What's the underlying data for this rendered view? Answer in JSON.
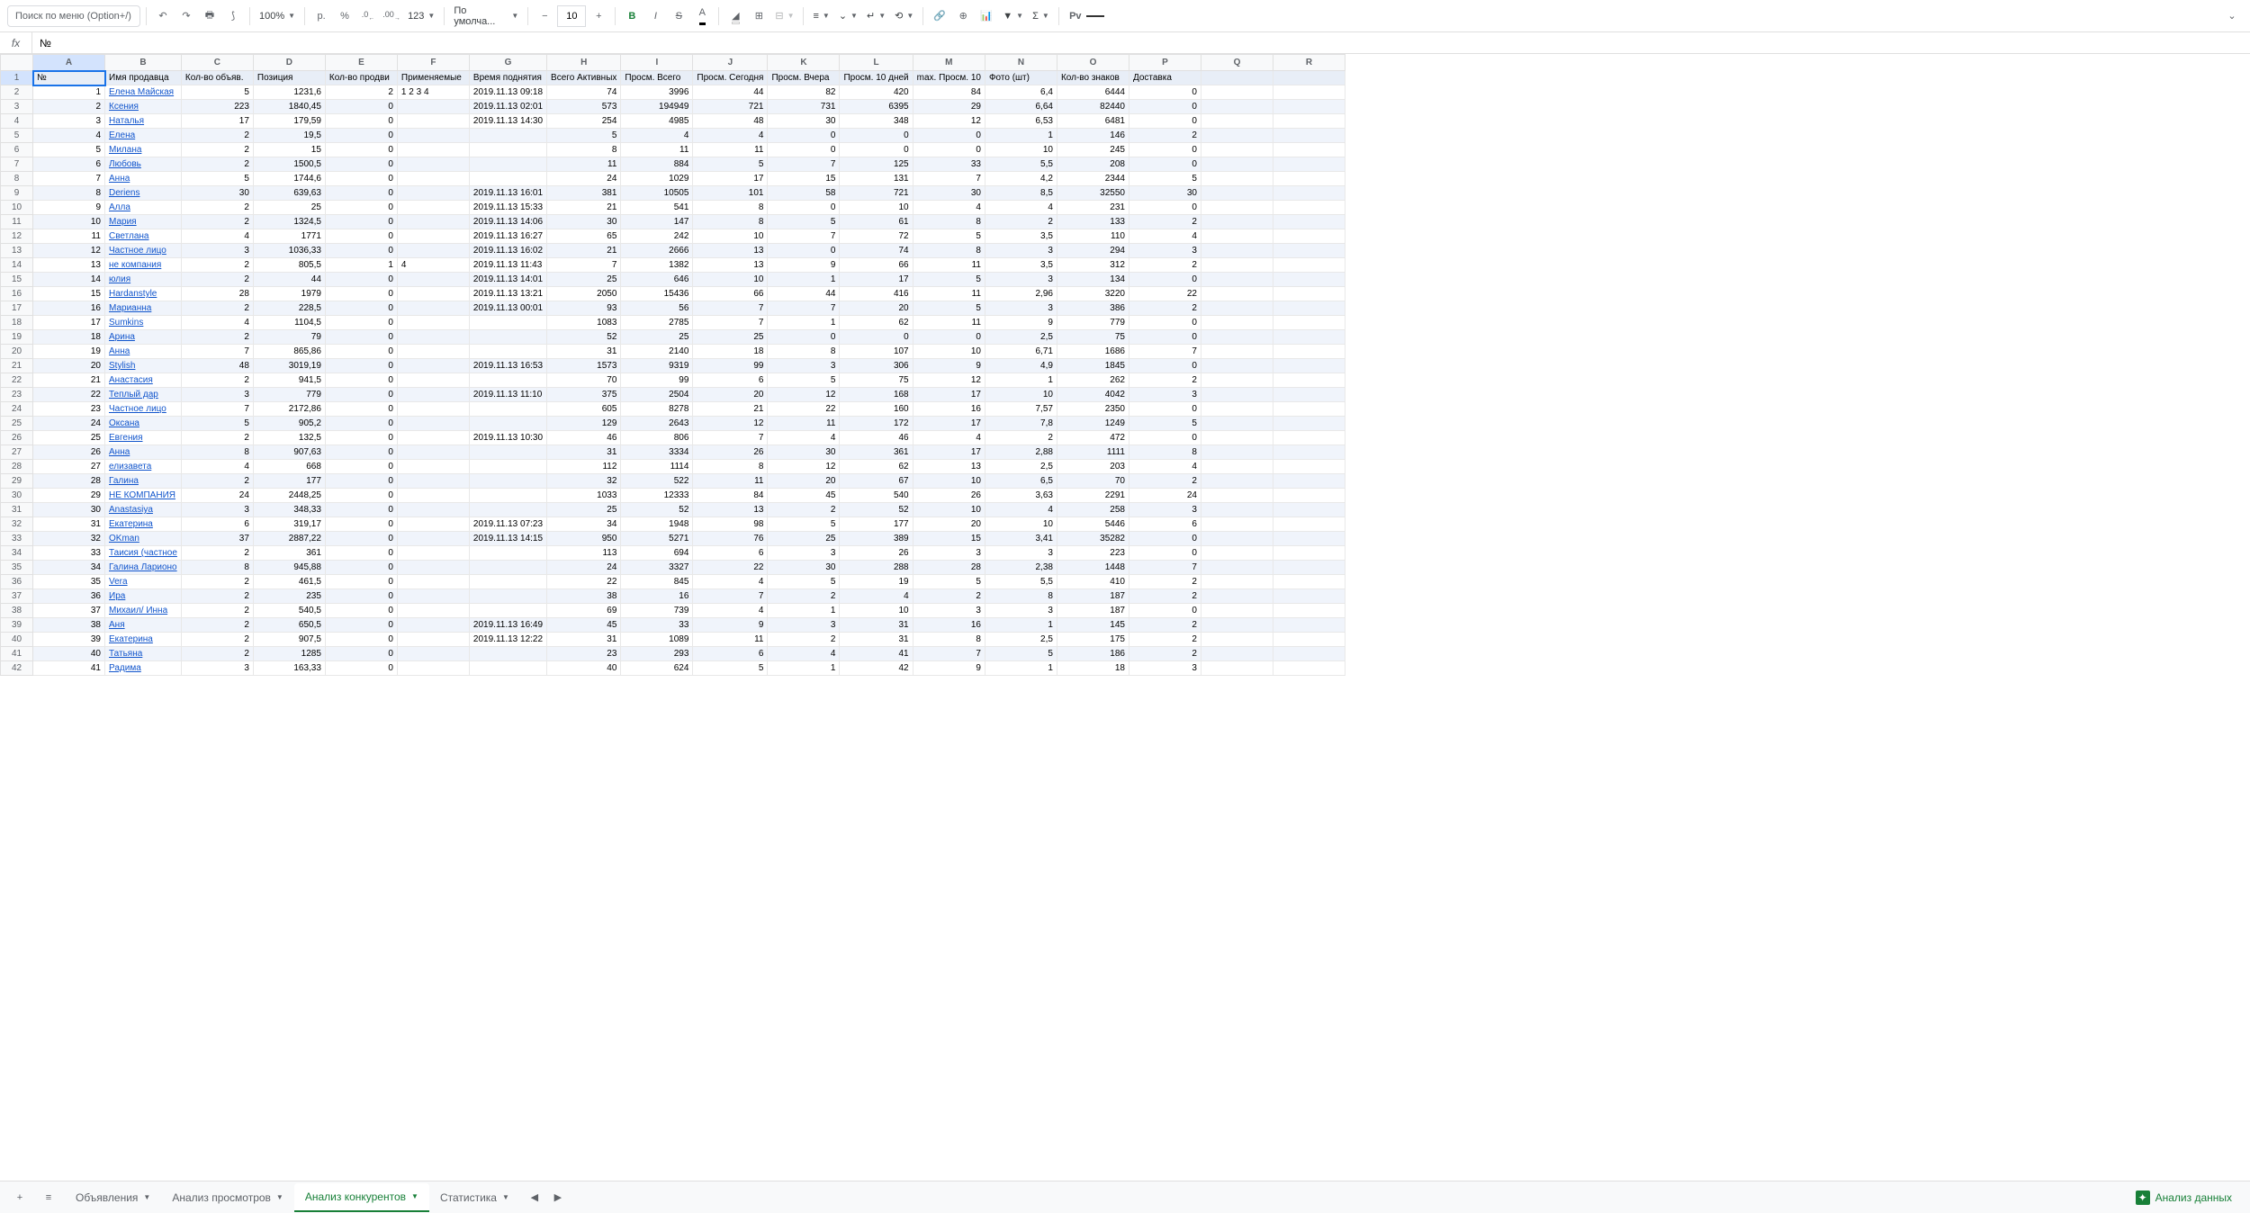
{
  "toolbar": {
    "search_placeholder": "Поиск по меню (Option+/)",
    "zoom": "100%",
    "currency": "р.",
    "percent": "%",
    "dec_minus": ".0",
    "dec_plus": ".00",
    "format_123": "123",
    "font": "По умолча...",
    "fontsize": "10",
    "p_label": "Рv"
  },
  "formula": {
    "fx": "fx",
    "value": "№"
  },
  "columns": [
    "A",
    "B",
    "C",
    "D",
    "E",
    "F",
    "G",
    "H",
    "I",
    "J",
    "K",
    "L",
    "M",
    "N",
    "O",
    "P",
    "Q",
    "R"
  ],
  "headers": [
    "№",
    "Имя продавца",
    "Кол-во объяв.",
    "Позиция",
    "Кол-во продви",
    "Применяемые",
    "Время поднятия",
    "Всего Активных",
    "Просм. Всего",
    "Просм. Сегодня",
    "Просм. Вчера",
    "Просм. 10 дней",
    "max. Просм. 10",
    "Фото (шт)",
    "Кол-во знаков",
    "Доставка",
    "",
    ""
  ],
  "rows": [
    [
      1,
      "Елена Майская",
      5,
      "1231,6",
      2,
      "1 2 3 4",
      "2019.11.13 09:18",
      74,
      3996,
      44,
      82,
      420,
      84,
      "6,4",
      6444,
      0
    ],
    [
      2,
      "Ксения",
      223,
      "1840,45",
      0,
      "",
      "2019.11.13 02:01",
      573,
      194949,
      721,
      731,
      6395,
      29,
      "6,64",
      82440,
      0
    ],
    [
      3,
      "Наталья",
      17,
      "179,59",
      0,
      "",
      "2019.11.13 14:30",
      254,
      4985,
      48,
      30,
      348,
      12,
      "6,53",
      6481,
      0
    ],
    [
      4,
      "Елена",
      2,
      "19,5",
      0,
      "",
      "",
      5,
      4,
      4,
      0,
      0,
      0,
      1,
      146,
      2
    ],
    [
      5,
      "Милана",
      2,
      15,
      0,
      "",
      "",
      8,
      11,
      11,
      0,
      0,
      0,
      10,
      245,
      0
    ],
    [
      6,
      "Любовь",
      2,
      "1500,5",
      0,
      "",
      "",
      11,
      884,
      5,
      7,
      125,
      33,
      "5,5",
      208,
      0
    ],
    [
      7,
      "Анна",
      5,
      "1744,6",
      0,
      "",
      "",
      24,
      1029,
      17,
      15,
      131,
      7,
      "4,2",
      2344,
      5
    ],
    [
      8,
      "Deriens",
      30,
      "639,63",
      0,
      "",
      "2019.11.13 16:01",
      381,
      10505,
      101,
      58,
      721,
      30,
      "8,5",
      32550,
      30
    ],
    [
      9,
      "Алла",
      2,
      25,
      0,
      "",
      "2019.11.13 15:33",
      21,
      541,
      8,
      0,
      10,
      4,
      4,
      231,
      0
    ],
    [
      10,
      "Мария",
      2,
      "1324,5",
      0,
      "",
      "2019.11.13 14:06",
      30,
      147,
      8,
      5,
      61,
      8,
      2,
      133,
      2
    ],
    [
      11,
      "Светлана",
      4,
      1771,
      0,
      "",
      "2019.11.13 16:27",
      65,
      242,
      10,
      7,
      72,
      5,
      "3,5",
      110,
      4
    ],
    [
      12,
      "Частное лицо",
      3,
      "1036,33",
      0,
      "",
      "2019.11.13 16:02",
      21,
      2666,
      13,
      0,
      74,
      8,
      3,
      294,
      3
    ],
    [
      13,
      "не компания",
      2,
      "805,5",
      1,
      "4",
      "2019.11.13 11:43",
      7,
      1382,
      13,
      9,
      66,
      11,
      "3,5",
      312,
      2
    ],
    [
      14,
      "юлия",
      2,
      44,
      0,
      "",
      "2019.11.13 14:01",
      25,
      646,
      10,
      1,
      17,
      5,
      3,
      134,
      0
    ],
    [
      15,
      "Hardanstyle",
      28,
      1979,
      0,
      "",
      "2019.11.13 13:21",
      2050,
      15436,
      66,
      44,
      416,
      11,
      "2,96",
      3220,
      22
    ],
    [
      16,
      "Марианна",
      2,
      "228,5",
      0,
      "",
      "2019.11.13 00:01",
      93,
      56,
      7,
      7,
      20,
      5,
      3,
      386,
      2
    ],
    [
      17,
      "Sumkins",
      4,
      "1104,5",
      0,
      "",
      "",
      1083,
      2785,
      7,
      1,
      62,
      11,
      9,
      779,
      0
    ],
    [
      18,
      "Арина",
      2,
      79,
      0,
      "",
      "",
      52,
      25,
      25,
      0,
      0,
      0,
      "2,5",
      75,
      0
    ],
    [
      19,
      "Анна",
      7,
      "865,86",
      0,
      "",
      "",
      31,
      2140,
      18,
      8,
      107,
      10,
      "6,71",
      1686,
      7
    ],
    [
      20,
      "Stylish",
      48,
      "3019,19",
      0,
      "",
      "2019.11.13 16:53",
      1573,
      9319,
      99,
      3,
      306,
      9,
      "4,9",
      1845,
      0
    ],
    [
      21,
      "Анастасия",
      2,
      "941,5",
      0,
      "",
      "",
      70,
      99,
      6,
      5,
      75,
      12,
      1,
      262,
      2
    ],
    [
      22,
      "Теплый дар",
      3,
      779,
      0,
      "",
      "2019.11.13 11:10",
      375,
      2504,
      20,
      12,
      168,
      17,
      10,
      4042,
      3
    ],
    [
      23,
      "Частное лицо",
      7,
      "2172,86",
      0,
      "",
      "",
      605,
      8278,
      21,
      22,
      160,
      16,
      "7,57",
      2350,
      0
    ],
    [
      24,
      "Оксана",
      5,
      "905,2",
      0,
      "",
      "",
      129,
      2643,
      12,
      11,
      172,
      17,
      "7,8",
      1249,
      5
    ],
    [
      25,
      "Евгения",
      2,
      "132,5",
      0,
      "",
      "2019.11.13 10:30",
      46,
      806,
      7,
      4,
      46,
      4,
      2,
      472,
      0
    ],
    [
      26,
      "Анна",
      8,
      "907,63",
      0,
      "",
      "",
      31,
      3334,
      26,
      30,
      361,
      17,
      "2,88",
      1111,
      8
    ],
    [
      27,
      "елизавета",
      4,
      668,
      0,
      "",
      "",
      112,
      1114,
      8,
      12,
      62,
      13,
      "2,5",
      203,
      4
    ],
    [
      28,
      "Галина",
      2,
      177,
      0,
      "",
      "",
      32,
      522,
      11,
      20,
      67,
      10,
      "6,5",
      70,
      2
    ],
    [
      29,
      "НЕ КОМПАНИЯ",
      24,
      "2448,25",
      0,
      "",
      "",
      1033,
      12333,
      84,
      45,
      540,
      26,
      "3,63",
      2291,
      24
    ],
    [
      30,
      "Anastasiya",
      3,
      "348,33",
      0,
      "",
      "",
      25,
      52,
      13,
      2,
      52,
      10,
      4,
      258,
      3
    ],
    [
      31,
      "Екатерина",
      6,
      "319,17",
      0,
      "",
      "2019.11.13 07:23",
      34,
      1948,
      98,
      5,
      177,
      20,
      10,
      5446,
      6
    ],
    [
      32,
      "OKman",
      37,
      "2887,22",
      0,
      "",
      "2019.11.13 14:15",
      950,
      5271,
      76,
      25,
      389,
      15,
      "3,41",
      35282,
      0
    ],
    [
      33,
      "Таисия (частное",
      2,
      361,
      0,
      "",
      "",
      113,
      694,
      6,
      3,
      26,
      3,
      3,
      223,
      0
    ],
    [
      34,
      "Галина Ларионо",
      8,
      "945,88",
      0,
      "",
      "",
      24,
      3327,
      22,
      30,
      288,
      28,
      "2,38",
      1448,
      7
    ],
    [
      35,
      "Vera",
      2,
      "461,5",
      0,
      "",
      "",
      22,
      845,
      4,
      5,
      19,
      5,
      "5,5",
      410,
      2
    ],
    [
      36,
      "Ира",
      2,
      235,
      0,
      "",
      "",
      38,
      16,
      7,
      2,
      4,
      2,
      8,
      187,
      2
    ],
    [
      37,
      "Михаил/ Инна",
      2,
      "540,5",
      0,
      "",
      "",
      69,
      739,
      4,
      1,
      10,
      3,
      3,
      187,
      0
    ],
    [
      38,
      "Аня",
      2,
      "650,5",
      0,
      "",
      "2019.11.13 16:49",
      45,
      33,
      9,
      3,
      31,
      16,
      1,
      145,
      2
    ],
    [
      39,
      "Екатерина",
      2,
      "907,5",
      0,
      "",
      "2019.11.13 12:22",
      31,
      1089,
      11,
      2,
      31,
      8,
      "2,5",
      175,
      2
    ],
    [
      40,
      "Татьяна",
      2,
      1285,
      0,
      "",
      "",
      23,
      293,
      6,
      4,
      41,
      7,
      5,
      186,
      2
    ],
    [
      41,
      "Радима",
      3,
      "163,33",
      0,
      "",
      "",
      40,
      624,
      5,
      1,
      42,
      9,
      1,
      18,
      3
    ]
  ],
  "sheets": {
    "tabs": [
      "Объявления",
      "Анализ просмотров",
      "Анализ конкурентов",
      "Статистика"
    ],
    "active": 2,
    "analyze": "Анализ данных"
  }
}
